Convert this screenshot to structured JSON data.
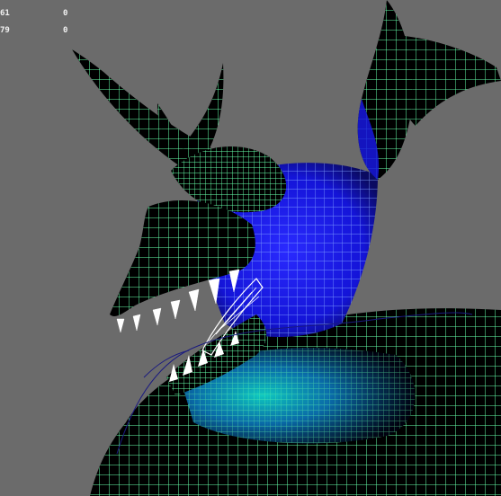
{
  "viewport": {
    "background_color": "#6b6b6b",
    "wire_color": "#66ffaa",
    "paint_color": "#1616ff",
    "highlight_color": "#00c8c8",
    "subject": "creature-head-wireframe"
  },
  "hud": {
    "rows": [
      {
        "label": "61",
        "value": "0"
      },
      {
        "label": "79",
        "value": "0"
      }
    ]
  }
}
